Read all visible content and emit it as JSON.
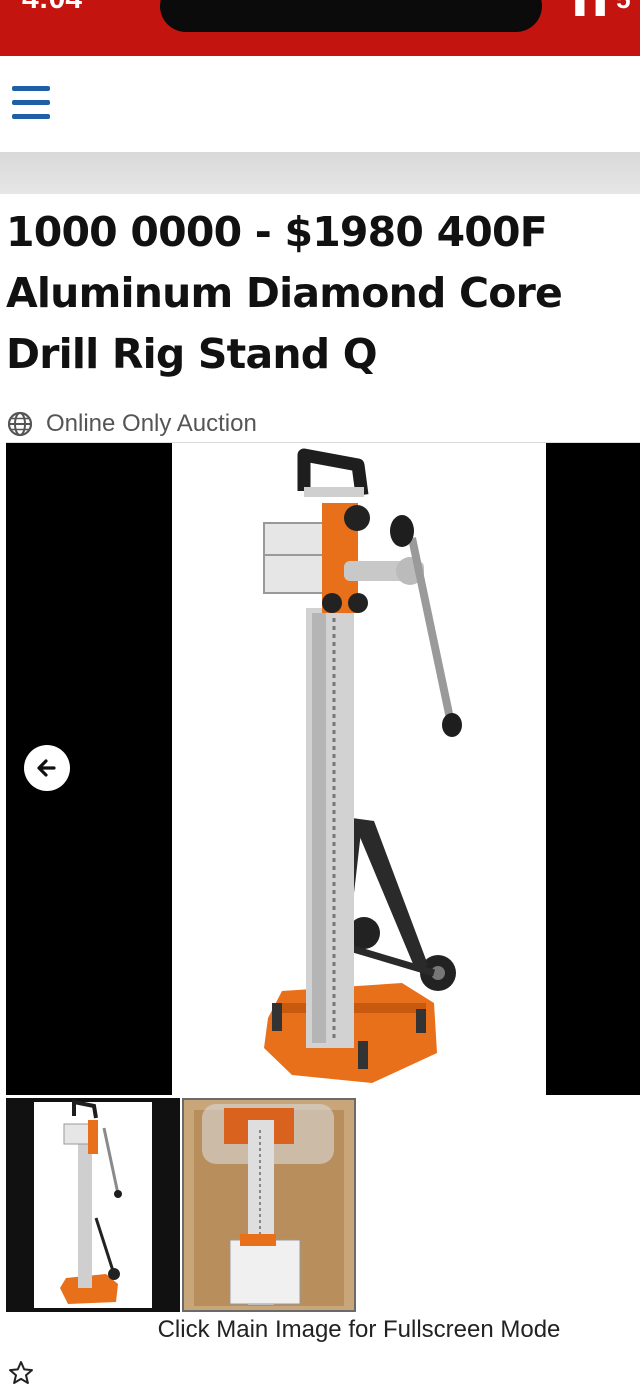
{
  "status_bar": {
    "time": "4:04",
    "right_indicators": "▐▐ 5"
  },
  "nav": {
    "menu_icon": "hamburger-menu-icon"
  },
  "listing": {
    "title": "1000 0000 - $1980 400F Aluminum Diamond Core Drill Rig Stand Q",
    "auction_type": "Online Only Auction",
    "auction_type_icon": "globe-icon"
  },
  "gallery": {
    "prev_icon": "arrow-left-icon",
    "thumbnails": [
      {
        "name": "thumbnail-drill-stand"
      },
      {
        "name": "thumbnail-drill-stand-in-box"
      }
    ],
    "hint": "Click Main Image for Fullscreen Mode"
  },
  "actions": {
    "watch_icon": "star-icon"
  },
  "colors": {
    "status_bar": "#c4140f",
    "menu_icon": "#1f5fa8",
    "stand_orange": "#e8701a",
    "stand_silver": "#d2d2d2"
  }
}
